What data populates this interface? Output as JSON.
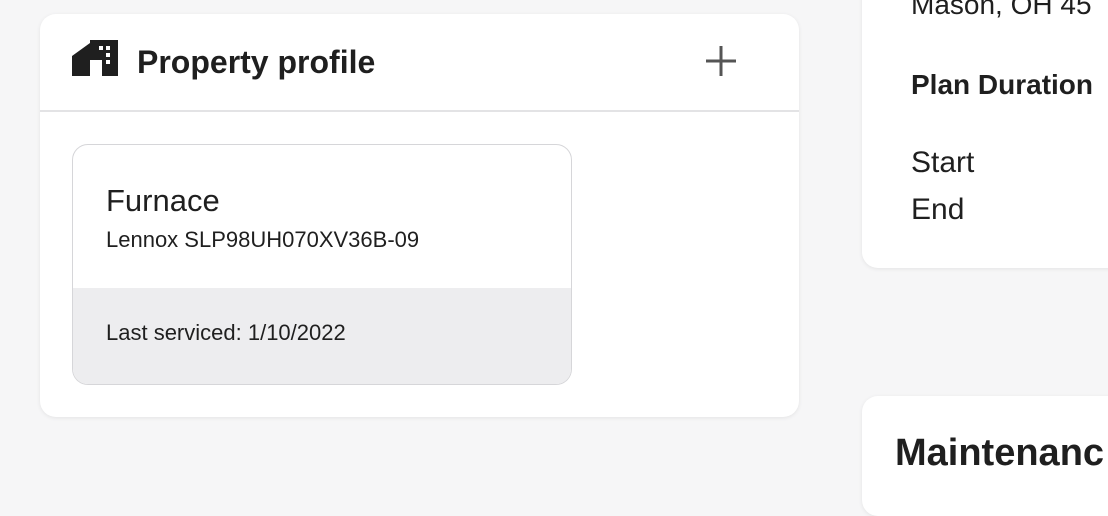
{
  "property_profile": {
    "title": "Property profile",
    "header_icon": "house-icon",
    "add_icon": "plus-icon",
    "assets": [
      {
        "name": "Furnace",
        "model": "Lennox SLP98UH070XV36B-09",
        "last_serviced": "Last serviced: 1/10/2022"
      }
    ]
  },
  "plan_details": {
    "address_partial": "Mason, OH 45",
    "duration_label": "Plan Duration",
    "start_label": "Start",
    "end_label": "End"
  },
  "maintenance": {
    "title_partial": "Maintenanc"
  },
  "colors": {
    "background": "#f6f6f7",
    "card": "#ffffff",
    "card_footer": "#ededef",
    "divider": "#e3e3e5",
    "text": "#1f1f1f",
    "icon": "#1f1f1f",
    "plus": "#555555"
  }
}
